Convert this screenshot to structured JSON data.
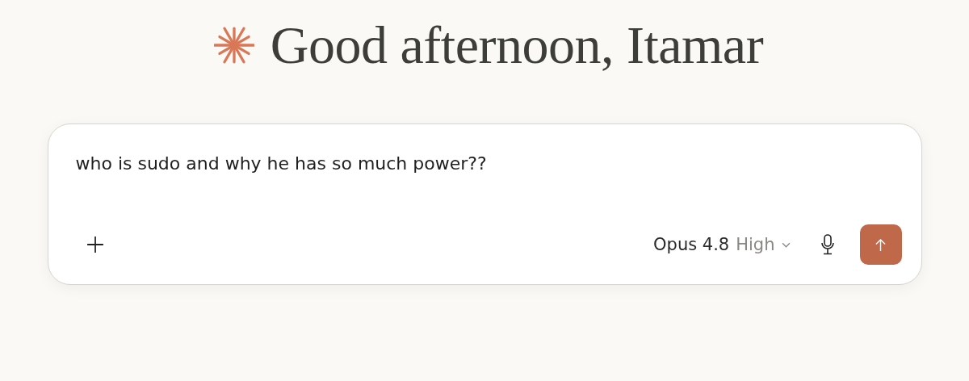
{
  "greeting": "Good afternoon, Itamar",
  "composer": {
    "value": "who is sudo and why he has so much power??",
    "model": {
      "name": "Opus 4.8",
      "effort": "High"
    }
  }
}
